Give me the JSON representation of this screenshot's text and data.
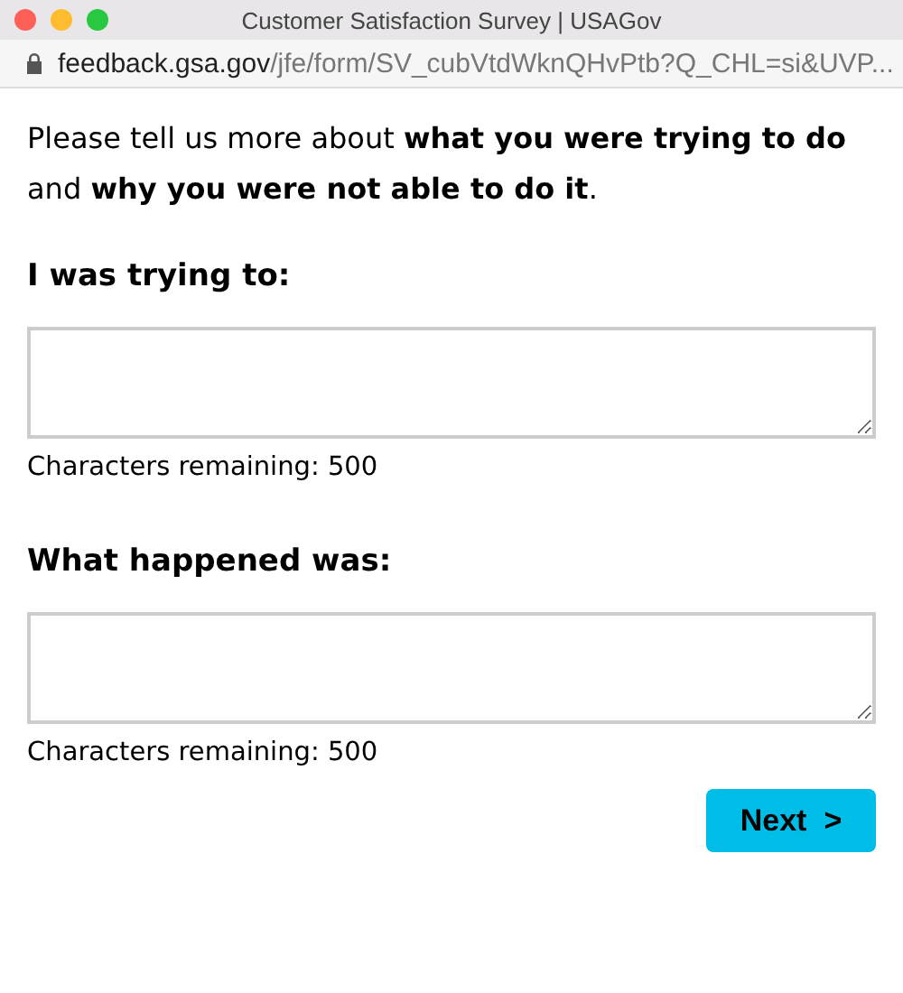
{
  "window": {
    "title": "Customer Satisfaction Survey | USAGov"
  },
  "address_bar": {
    "host": "feedback.gsa.gov",
    "path": "/jfe/form/SV_cubVtdWknQHvPtb?Q_CHL=si&UVP..."
  },
  "intro": "Please tell us more about **what you were trying to do** and **why you were not able to do it**.",
  "questions": [
    {
      "label": "I was trying to:",
      "counter": "Characters remaining: 500"
    },
    {
      "label": "What happened was:",
      "counter": "Characters remaining: 500"
    }
  ],
  "next_button": {
    "label": "Next",
    "arrow": ">"
  }
}
